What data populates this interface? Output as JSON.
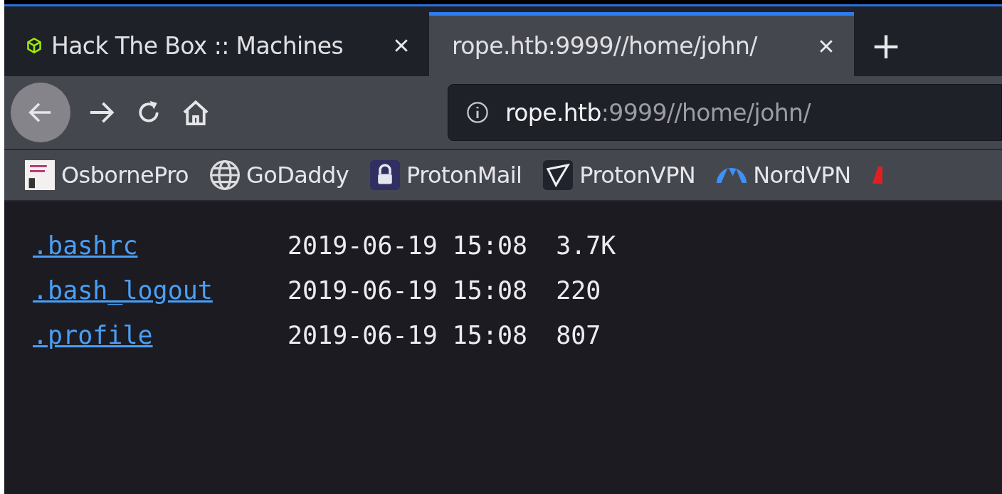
{
  "tabs": [
    {
      "title": "Hack The Box :: Machines",
      "selected": false
    },
    {
      "title": "rope.htb:9999//home/john/",
      "selected": true
    }
  ],
  "new_tab": "+",
  "address_bar": {
    "host": "rope.htb",
    "rest": ":9999//home/john/"
  },
  "bookmarks": [
    {
      "label": "OsbornePro"
    },
    {
      "label": "GoDaddy"
    },
    {
      "label": "ProtonMail"
    },
    {
      "label": "ProtonVPN"
    },
    {
      "label": "NordVPN"
    }
  ],
  "listing": [
    {
      "name": ".bashrc",
      "date": "2019-06-19 15:08",
      "size": "3.7K"
    },
    {
      "name": ".bash_logout",
      "date": "2019-06-19 15:08",
      "size": "220"
    },
    {
      "name": ".profile",
      "date": "2019-06-19 15:08",
      "size": "807"
    }
  ]
}
